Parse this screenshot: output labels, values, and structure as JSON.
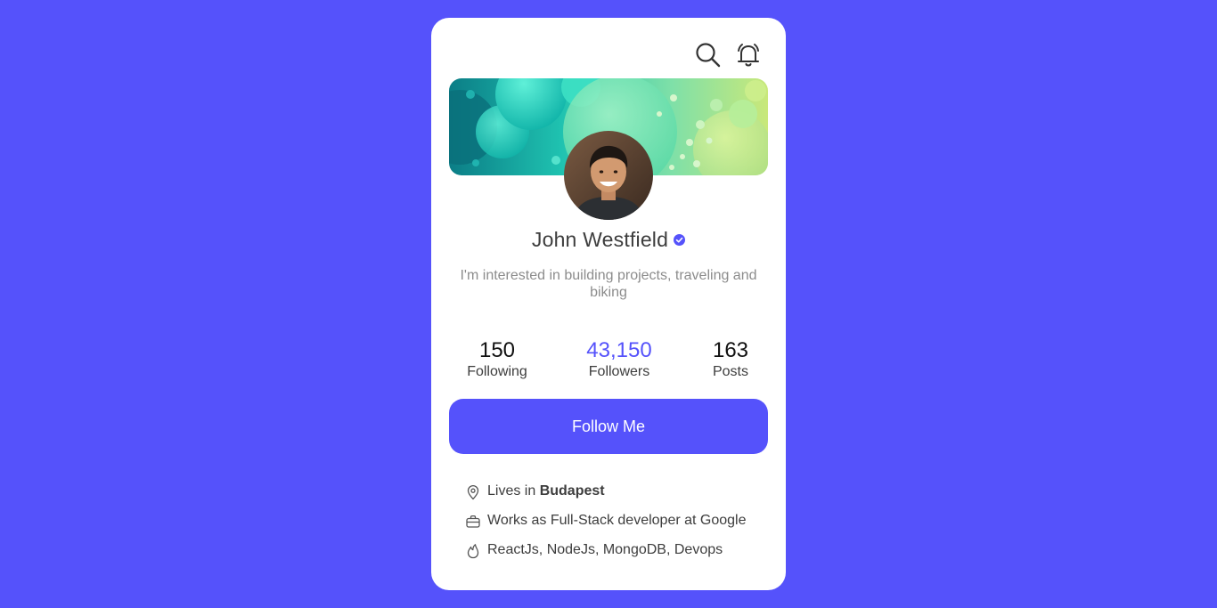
{
  "colors": {
    "background": "#5552fb",
    "accent": "#5552fb",
    "card": "#ffffff",
    "text_dark": "#3d3d3d",
    "text_muted": "#8c8c8c"
  },
  "header": {
    "icons": [
      "search-icon",
      "bell-icon"
    ]
  },
  "profile": {
    "name": "John Westfield",
    "verified_icon": "verified-badge-icon",
    "bio": "I'm interested in building projects, traveling and biking"
  },
  "stats": [
    {
      "value": "150",
      "label": "Following"
    },
    {
      "value": "43,150",
      "label": "Followers"
    },
    {
      "value": "163",
      "label": "Posts"
    }
  ],
  "follow_button": {
    "label": "Follow Me"
  },
  "info": {
    "location_prefix": "Lives in",
    "location_city": "Budapest",
    "work": "Works as Full-Stack developer at Google",
    "skills": "ReactJs, NodeJs, MongoDB, Devops"
  }
}
